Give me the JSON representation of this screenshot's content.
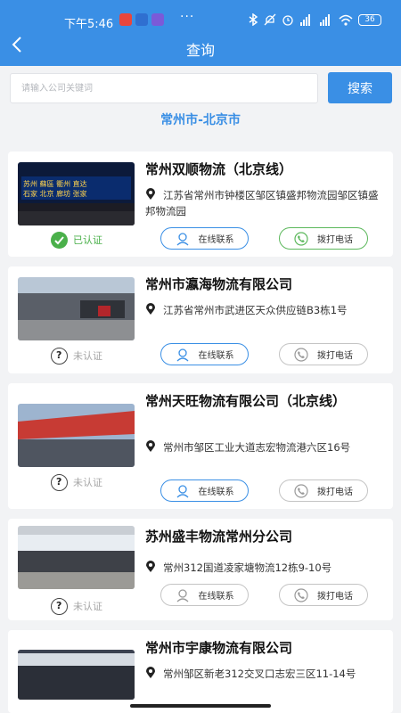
{
  "status": {
    "time": "下午5:46",
    "icons": [
      "cast-icon",
      "translate-icon",
      "app-icon"
    ],
    "battery": "36"
  },
  "nav": {
    "title": "查询",
    "back_icon": "chevron-left-icon"
  },
  "search": {
    "placeholder": "请输入公司关键词",
    "button_label": "搜索"
  },
  "route": "常州市-北京市",
  "labels": {
    "online": "在线联系",
    "call": "拨打电话",
    "verified": "已认证",
    "unverified": "未认证"
  },
  "companies": [
    {
      "name": "常州双顺物流（北京线）",
      "address": "江苏省常州市钟楼区邹区镇盛邦物流园邹区镇盛邦物流园",
      "verified": true,
      "image_sign": [
        "苏州 蘇區 衢州 直达",
        "石家 北京 廊坊 张家"
      ]
    },
    {
      "name": "常州市瀛海物流有限公司",
      "address": "江苏省常州市武进区天众供应链B3栋1号",
      "verified": false
    },
    {
      "name": "常州天旺物流有限公司（北京线）",
      "address": "常州市邹区工业大道志宏物流港六区16号",
      "verified": false
    },
    {
      "name": "苏州盛丰物流常州分公司",
      "address": "常州312国道凌家塘物流12栋9-10号",
      "verified": false
    },
    {
      "name": "常州市宇康物流有限公司",
      "address": "常州邹区新老312交叉口志宏三区11-14号",
      "verified": false
    }
  ],
  "colors": {
    "primary": "#3a8fe5",
    "verified_green": "#4ab04a",
    "muted": "#a6a6a6"
  }
}
